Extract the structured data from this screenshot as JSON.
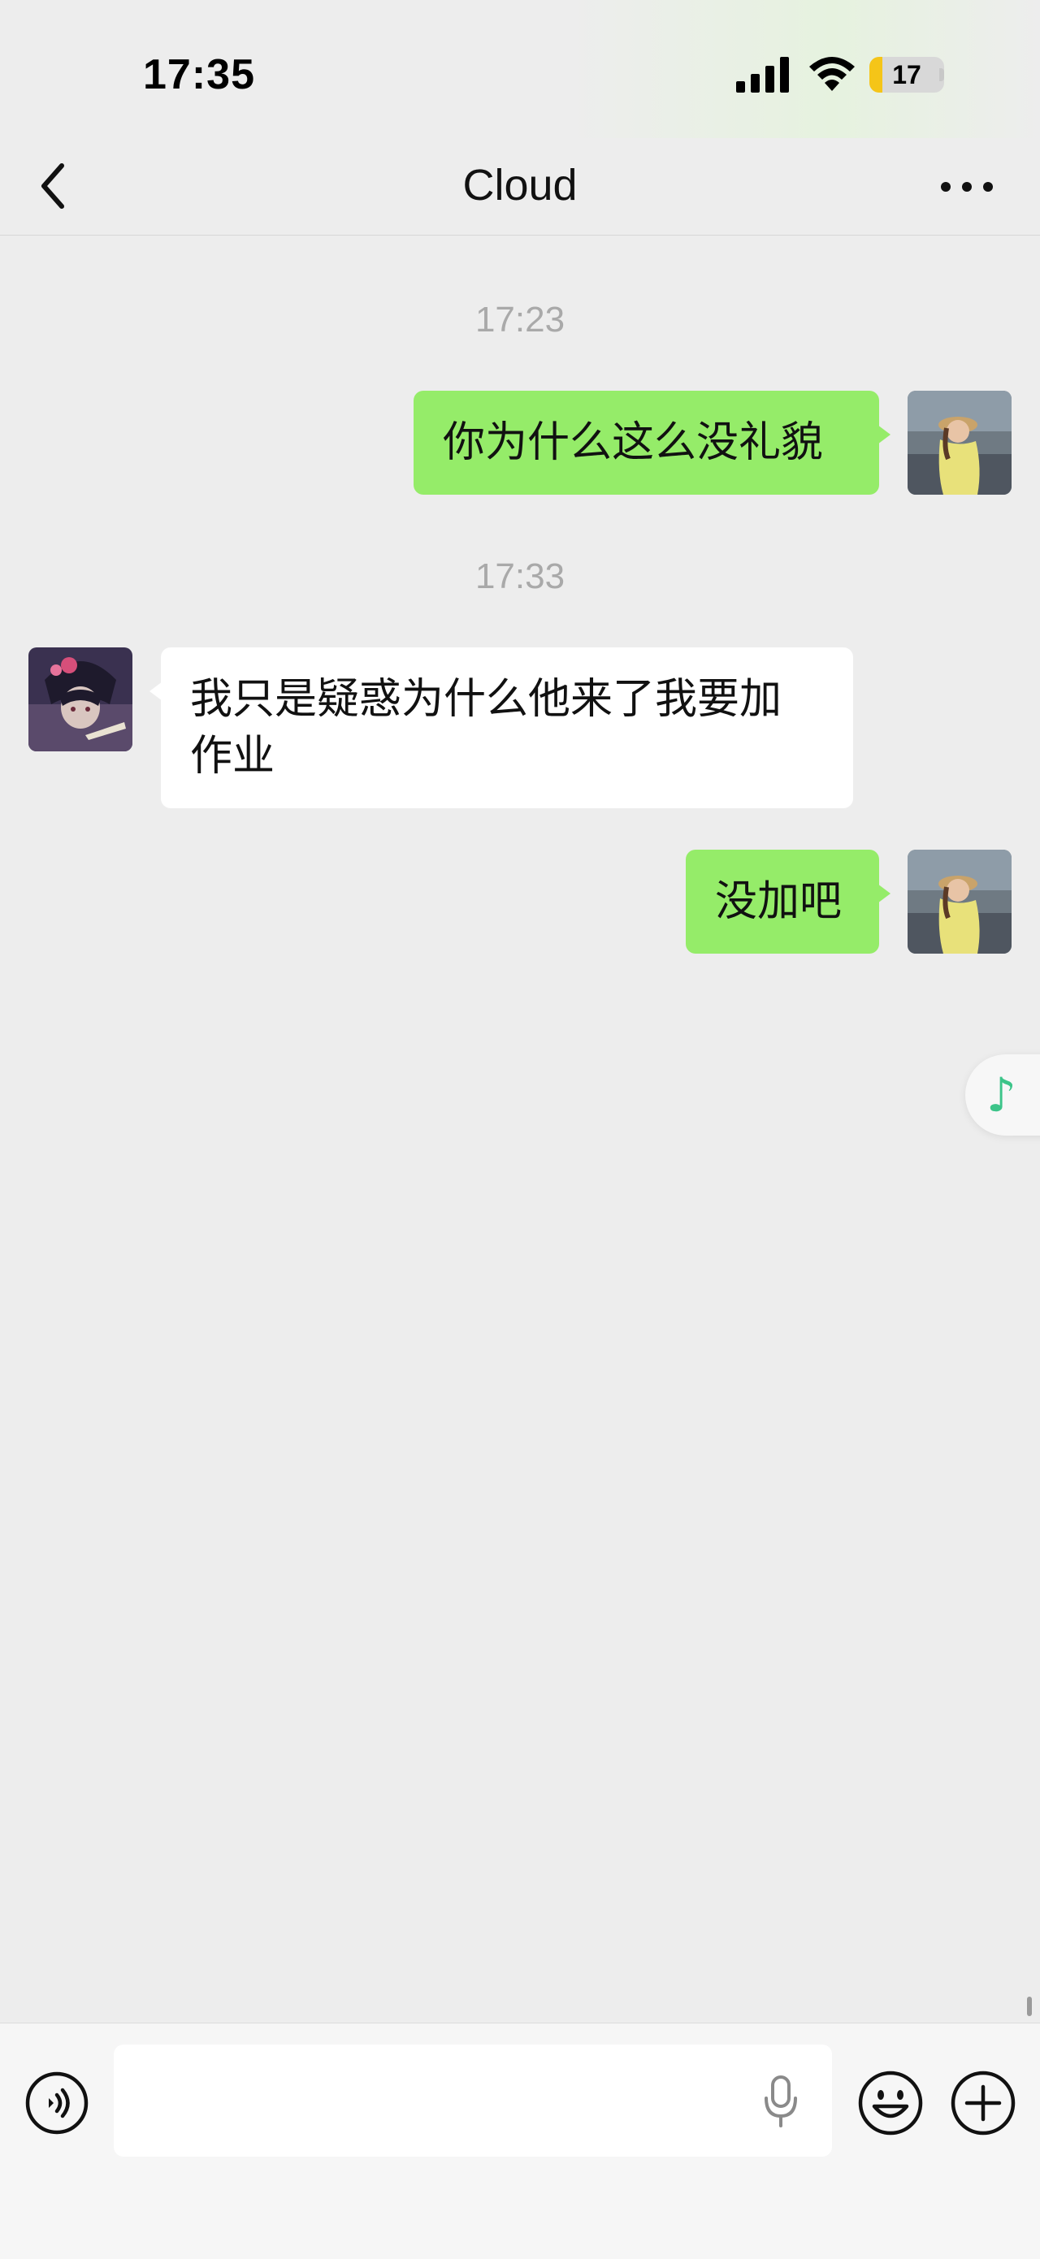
{
  "status_bar": {
    "time": "17:35",
    "battery_level": "17",
    "battery_fraction": 0.17
  },
  "nav": {
    "title": "Cloud",
    "back_icon": "chevron-left-icon",
    "more_icon": "more-dots-icon"
  },
  "messages": [
    {
      "type": "timestamp",
      "text": "17:23"
    },
    {
      "type": "message",
      "sender": "me",
      "text": "你为什么这么没礼貌"
    },
    {
      "type": "timestamp",
      "text": "17:33"
    },
    {
      "type": "message",
      "sender": "other",
      "text_line1": "我只是疑惑为什么他来了我要加",
      "text_line2": "作业"
    },
    {
      "type": "message",
      "sender": "me",
      "text": "没加吧"
    }
  ],
  "floating": {
    "icon": "music-note-icon",
    "glyph": "♪"
  },
  "input_bar": {
    "voice_icon": "voice-icon",
    "input_value": "",
    "mic_icon": "microphone-icon",
    "emoji_icon": "emoji-icon",
    "plus_icon": "plus-icon"
  },
  "colors": {
    "background": "#ededed",
    "my_bubble": "#95ec69",
    "other_bubble": "#ffffff",
    "timestamp_text": "#a9a9a9",
    "music_icon": "#3cc489",
    "battery_fill": "#f5c518"
  }
}
